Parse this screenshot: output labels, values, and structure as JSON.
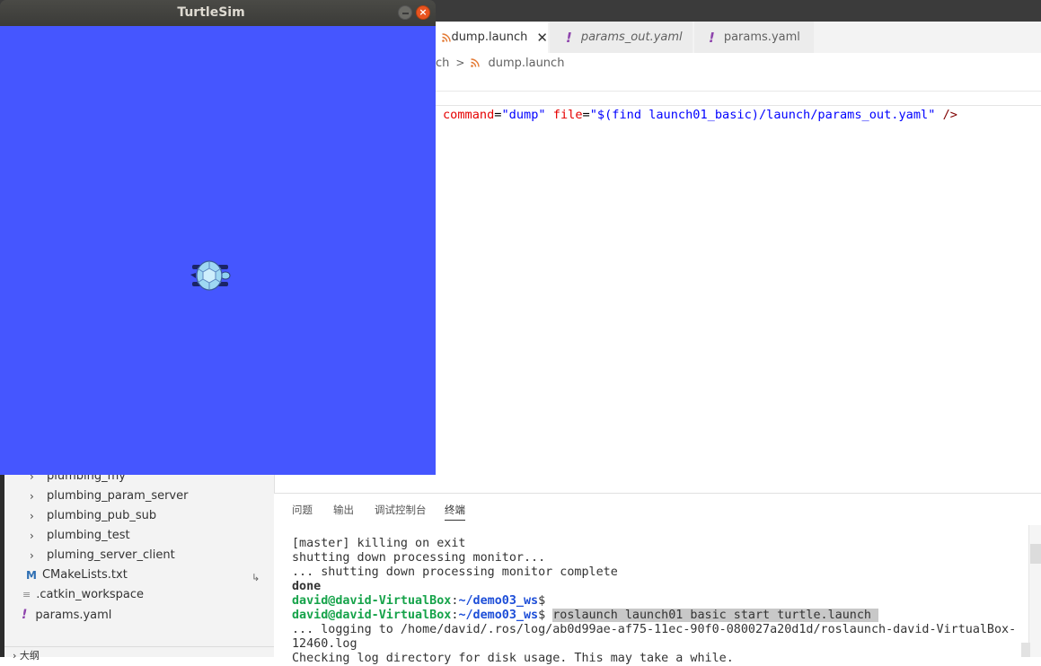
{
  "editor": {
    "tabs": [
      {
        "label": "dump.launch",
        "active": true,
        "icon": "rss-icon"
      },
      {
        "label": "params_out.yaml",
        "active": false,
        "icon": "exclamation-icon"
      },
      {
        "label": "params.yaml",
        "active": false,
        "icon": "exclamation-icon"
      }
    ],
    "breadcrumb": {
      "parent": "ch",
      "file": "dump.launch"
    },
    "code": {
      "attr1": "command",
      "val1": "\"dump\"",
      "attr2": "file",
      "val2": "\"$(find launch01_basic)/launch/params_out.yaml\"",
      "close": "/>"
    }
  },
  "sidebar": {
    "items": [
      {
        "label": "plumbing_my"
      },
      {
        "label": "plumbing_param_server"
      },
      {
        "label": "plumbing_pub_sub"
      },
      {
        "label": "plumbing_test"
      },
      {
        "label": "pluming_server_client"
      },
      {
        "label": "CMakeLists.txt"
      },
      {
        "label": ".catkin_workspace"
      },
      {
        "label": "params.yaml"
      }
    ],
    "outline_label": "大纲"
  },
  "panel": {
    "tabs": [
      "问题",
      "输出",
      "调试控制台",
      "终端"
    ],
    "active_tab": "终端"
  },
  "terminal": {
    "line1": "[master] killing on exit",
    "line2": "shutting down processing monitor...",
    "line3": "... shutting down processing monitor complete",
    "line4": "done",
    "prompt_user": "david@david-VirtualBox",
    "prompt_colon": ":",
    "prompt_path": "~/demo03_ws",
    "prompt_dollar": "$",
    "command": "roslaunch launch01 basic start turtle.launch ",
    "line7": "... logging to /home/david/.ros/log/ab0d99ae-af75-11ec-90f0-080027a20d1d/roslaunch-david-VirtualBox-",
    "line8": "12460.log",
    "line9": "Checking log directory for disk usage. This may take a while."
  },
  "turtlesim": {
    "title": "TurtleSim",
    "close_symbol": "×",
    "background_color": "#4556ff"
  },
  "colors": {
    "terminal_user": "#16a34a",
    "terminal_path": "#1d4ed8",
    "ubuntu_close": "#e95420"
  }
}
